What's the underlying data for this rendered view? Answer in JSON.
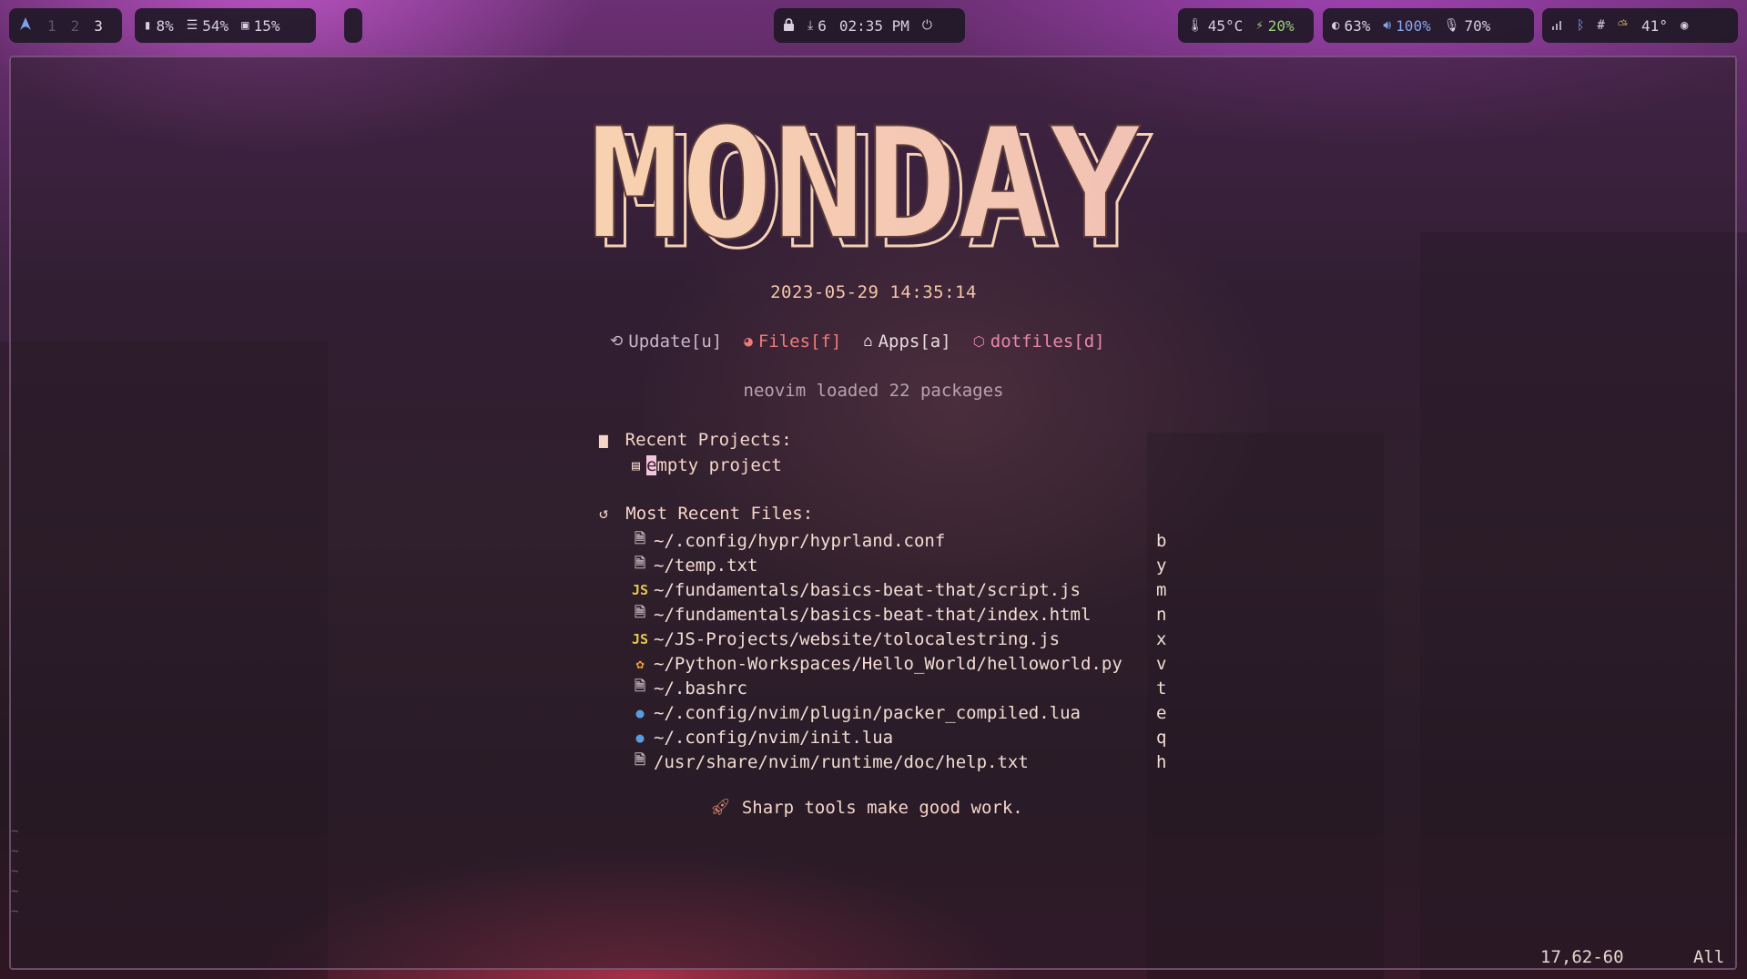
{
  "colors": {
    "accent_pink": "#f07aa0",
    "accent_blue": "#8aa8e8",
    "accent_green": "#9ad07a",
    "peach": "#f5c7a9",
    "js_yellow": "#e5c84a",
    "lua_blue": "#5a9ce0",
    "py_orange": "#f0a030"
  },
  "topbar": {
    "workspaces": [
      "1",
      "2",
      "3"
    ],
    "active_workspace": "3",
    "cpu": "8%",
    "memory": "54%",
    "disk": "15%",
    "updates": "6",
    "clock": "02:35 PM",
    "temperature": "45°C",
    "battery": "20%",
    "brightness": "63%",
    "volume": "100%",
    "mic": "70%",
    "weather": "41°"
  },
  "dashboard": {
    "header": "MONDAY",
    "datetime": "2023-05-29 14:35:14",
    "actions": [
      {
        "label": "Update[u]",
        "icon": "update-icon",
        "color": "#c8b8c8"
      },
      {
        "label": "Files[f]",
        "icon": "telescope-icon",
        "color": "#f07a7a"
      },
      {
        "label": "Apps[a]",
        "icon": "home-icon",
        "color": "#e8dcdc"
      },
      {
        "label": "dotfiles[d]",
        "icon": "package-icon",
        "color": "#e88aa8"
      }
    ],
    "loaded_text": "neovim loaded 22 packages",
    "recent_projects_title": "Recent Projects:",
    "project_first_char": "e",
    "project_rest": "mpty project",
    "recent_files_title": "Most Recent Files:",
    "files": [
      {
        "path": "~/.config/hypr/hyprland.conf",
        "key": "b",
        "icon": "file-icon"
      },
      {
        "path": "~/temp.txt",
        "key": "y",
        "icon": "file-icon"
      },
      {
        "path": "~/fundamentals/basics-beat-that/script.js",
        "key": "m",
        "icon": "js-icon"
      },
      {
        "path": "~/fundamentals/basics-beat-that/index.html",
        "key": "n",
        "icon": "file-icon"
      },
      {
        "path": "~/JS-Projects/website/tolocalestring.js",
        "key": "x",
        "icon": "js-icon"
      },
      {
        "path": "~/Python-Workspaces/Hello_World/helloworld.py",
        "key": "v",
        "icon": "python-icon"
      },
      {
        "path": "~/.bashrc",
        "key": "t",
        "icon": "file-icon"
      },
      {
        "path": "~/.config/nvim/plugin/packer_compiled.lua",
        "key": "e",
        "icon": "lua-icon"
      },
      {
        "path": "~/.config/nvim/init.lua",
        "key": "q",
        "icon": "lua-icon"
      },
      {
        "path": "/usr/share/nvim/runtime/doc/help.txt",
        "key": "h",
        "icon": "file-icon"
      }
    ],
    "quote": "Sharp tools make good work."
  },
  "statusline": {
    "position": "17,62-60",
    "scroll": "All"
  }
}
